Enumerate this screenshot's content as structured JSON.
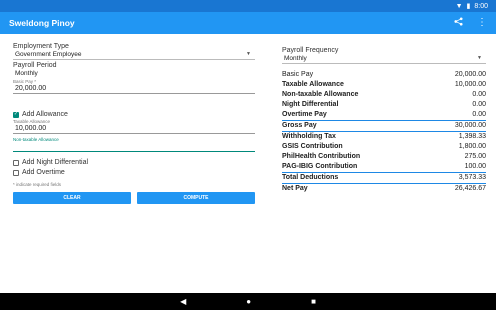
{
  "status": {
    "time": "8:00",
    "wifi_icon": "wifi-icon",
    "battery_icon": "battery-icon"
  },
  "app": {
    "title": "Sweldong Pinoy",
    "share_icon": "share-icon",
    "menu_icon": "more-vert-icon"
  },
  "left": {
    "employment_type_label": "Employment Type",
    "employment_type_value": "Government Employee",
    "payroll_period_label": "Payroll Period",
    "payroll_period_value": "Monthly",
    "basic_pay_hint": "Basic Pay *",
    "basic_pay_value": "20,000.00",
    "add_allowance_label": "Add Allowance",
    "taxable_allowance_hint": "Taxable Allowance",
    "taxable_allowance_value": "10,000.00",
    "nontaxable_allowance_hint": "Non-taxable Allowance",
    "add_night_diff_label": "Add Night Differential",
    "add_overtime_label": "Add Overtime",
    "required_note": "* indicate required fields",
    "clear_label": "CLEAR",
    "compute_label": "COMPUTE"
  },
  "right": {
    "payroll_frequency_label": "Payroll Frequency",
    "payroll_frequency_value": "Monthly",
    "rows": [
      {
        "label": "Basic Pay",
        "value": "20,000.00"
      },
      {
        "label": "Taxable Allowance",
        "value": "10,000.00"
      },
      {
        "label": "Non-taxable Allowance",
        "value": "0.00"
      },
      {
        "label": "Night Differential",
        "value": "0.00"
      },
      {
        "label": "Overtime Pay",
        "value": "0.00"
      },
      {
        "label": "Gross Pay",
        "value": "30,000.00"
      },
      {
        "label": "Withholding Tax",
        "value": "1,398.33"
      },
      {
        "label": "GSIS Contribution",
        "value": "1,800.00"
      },
      {
        "label": "PhilHealth Contribution",
        "value": "275.00"
      },
      {
        "label": "PAG-IBIG Contribution",
        "value": "100.00"
      },
      {
        "label": "Total Deductions",
        "value": "3,573.33"
      },
      {
        "label": "Net Pay",
        "value": "26,426.67"
      }
    ]
  },
  "colors": {
    "primary": "#2196f3",
    "status": "#1976d2",
    "accent": "#00897b"
  }
}
